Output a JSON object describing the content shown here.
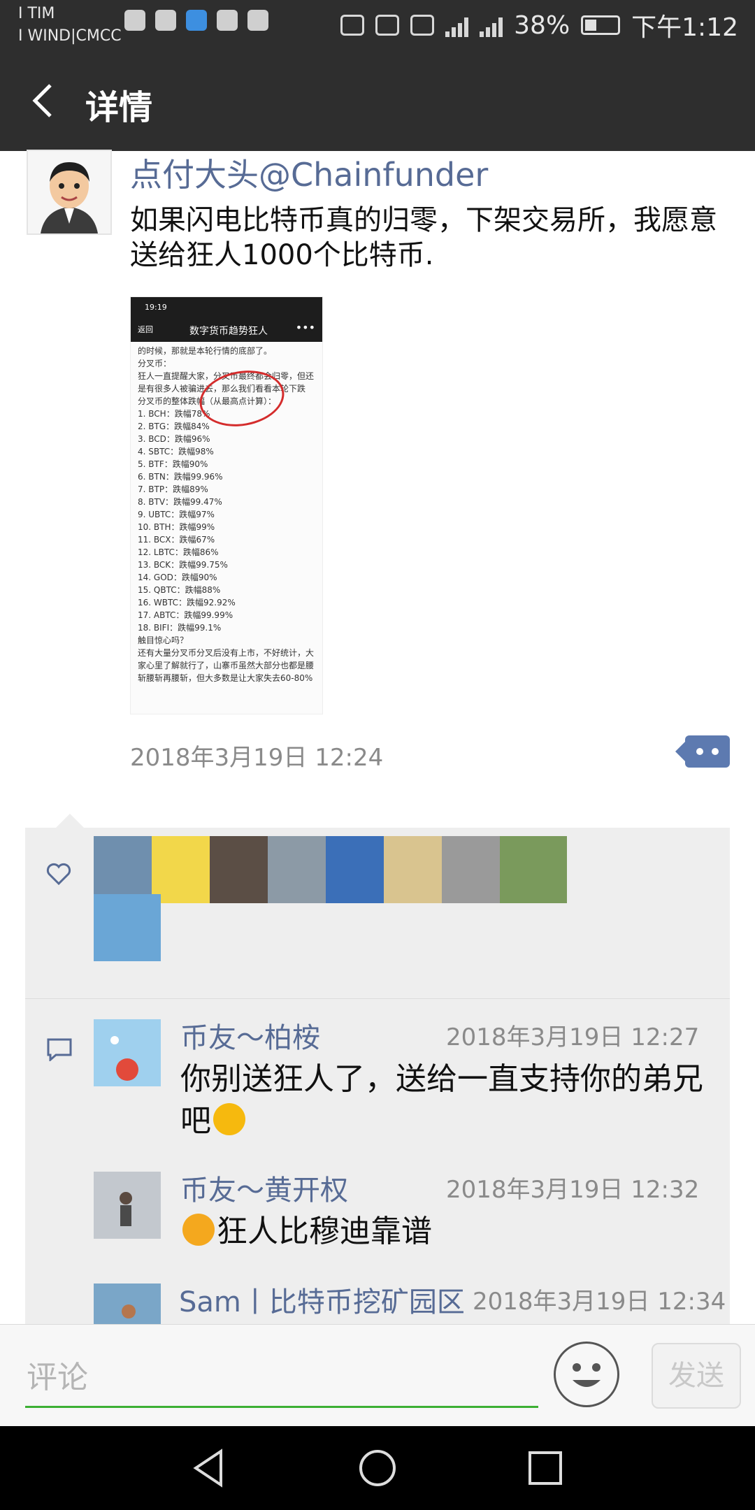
{
  "status_bar": {
    "carrier_line1": "I TIM",
    "carrier_line2": "I WIND|CMCC",
    "battery": "38%",
    "time": "下午1:12"
  },
  "nav": {
    "title": "详情"
  },
  "post": {
    "author": "点付大头@Chainfunder",
    "text": "如果闪电比特币真的归零，下架交易所，我愿意送给狂人1000个比特币.",
    "time": "2018年3月19日 12:24",
    "image": {
      "phone_time": "19:19",
      "back": "返回",
      "title": "数字货币趋势狂人",
      "more": "•••",
      "lines": [
        "的时候，那就是本轮行情的底部了。",
        "分叉币：",
        "狂人一直提醒大家，分叉币最终都会归零，但还",
        "是有很多人被骗进去，那么我们看看本轮下跌",
        "分叉币的整体跌幅（从最高点计算）：",
        "1. BCH：跌幅78%",
        "2. BTG：跌幅84%",
        "3. BCD：跌幅96%",
        "4. SBTC：跌幅98%",
        "5. BTF：跌幅90%",
        "6. BTN：跌幅99.96%",
        "7. BTP：跌幅89%",
        "8. BTV：跌幅99.47%",
        "9. UBTC：跌幅97%",
        "10. BTH：跌幅99%",
        "11. BCX：跌幅67%",
        "12. LBTC：跌幅86%",
        "13. BCK：跌幅99.75%",
        "14. GOD：跌幅90%",
        "15. QBTC：跌幅88%",
        "16. WBTC：跌幅92.92%",
        "17. ABTC：跌幅99.99%",
        "18. BIFI：跌幅99.1%",
        "触目惊心吗？",
        "还有大量分叉币分叉后没有上市，不好统计，大",
        "家心里了解就行了，山寨币虽然大部分也都是腰",
        "斩腰斩再腰斩，但大多数是让大家失去60-80%"
      ]
    }
  },
  "likes": {
    "avatars": [
      {
        "name": "like-avatar-1",
        "color": "#6f8fae"
      },
      {
        "name": "like-avatar-2",
        "color": "#f2d74a"
      },
      {
        "name": "like-avatar-3",
        "color": "#5b4e45"
      },
      {
        "name": "like-avatar-4",
        "color": "#8c9aa6"
      },
      {
        "name": "like-avatar-5",
        "color": "#3b6fb8"
      },
      {
        "name": "like-avatar-6",
        "color": "#d9c48f"
      },
      {
        "name": "like-avatar-7",
        "color": "#9a9a9a"
      },
      {
        "name": "like-avatar-8",
        "color": "#7a9a5c"
      },
      {
        "name": "like-avatar-9",
        "color": "#6aa6d6"
      }
    ]
  },
  "comments": [
    {
      "name": "币友～柏桉",
      "time": "2018年3月19日 12:27",
      "text": "你别送狂人了，送给一直支持你的弟兄吧",
      "emoji": "thinking-emoji"
    },
    {
      "name": "币友～黄开权",
      "time": "2018年3月19日 12:32",
      "text": "狂人比穆迪靠谱",
      "emoji": "grinning-emoji"
    },
    {
      "name": "Sam丨比特币挖矿园区",
      "time": "2018年3月19日 12:34",
      "text": ""
    }
  ],
  "input": {
    "placeholder": "评论",
    "send_label": "发送"
  },
  "colors": {
    "link": "#576b95",
    "header": "#2e2e2e",
    "accent_line": "#3cb034"
  }
}
